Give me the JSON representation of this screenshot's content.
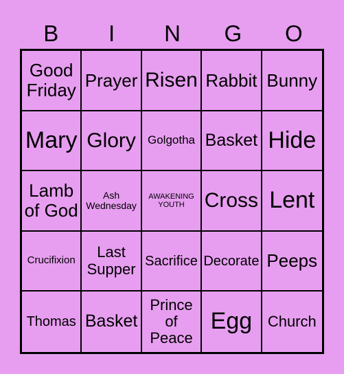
{
  "header": [
    "B",
    "I",
    "N",
    "G",
    "O"
  ],
  "cells": [
    "Good Friday",
    "Prayer",
    "Risen",
    "Rabbit",
    "Bunny",
    "Mary",
    "Glory",
    "Golgotha",
    "Basket",
    "Hide",
    "Lamb of God",
    "Ash Wednesday",
    "AWAKENING YOUTH",
    "Cross",
    "Lent",
    "Crucifixion",
    "Last Supper",
    "Sacrifice",
    "Decorate",
    "Peeps",
    "Thomas",
    "Basket",
    "Prince of Peace",
    "Egg",
    "Church"
  ],
  "colors": {
    "background": "#e79ef0",
    "lines": "#000000"
  }
}
